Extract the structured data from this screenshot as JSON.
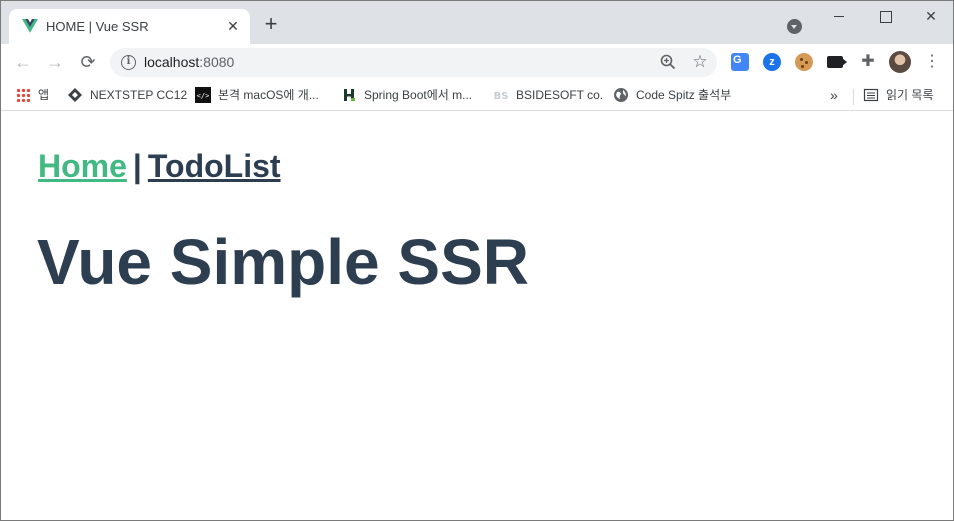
{
  "tab": {
    "title": "HOME | Vue SSR",
    "close_glyph": "✕",
    "new_tab_glyph": "+"
  },
  "toolbar": {
    "back_glyph": "←",
    "forward_glyph": "→",
    "reload_glyph": "⟳",
    "url_host": "localhost",
    "url_port": ":8080",
    "info_glyph": "i",
    "star_glyph": "☆",
    "ext_z_label": "z",
    "puzzle_glyph": "✚",
    "menu_glyph": "⋮"
  },
  "bookmarks": {
    "items": [
      {
        "label": "앱",
        "icon": "apps-grid-icon"
      },
      {
        "label": "NEXTSTEP CC12",
        "icon": "nextstep-icon"
      },
      {
        "label": "본격 macOS에 개...",
        "icon": "code-icon"
      },
      {
        "label": "Spring Boot에서 m...",
        "icon": "spring-icon"
      },
      {
        "label": "BSIDESOFT co.",
        "icon": "bsidesoft-icon"
      },
      {
        "label": "Code Spitz 출석부",
        "icon": "globe-icon"
      }
    ],
    "more_glyph": "»",
    "reading_list_label": "읽기 목록"
  },
  "page": {
    "nav_home": "Home",
    "nav_separator": "|",
    "nav_todo": "TodoList",
    "heading": "Vue Simple SSR"
  },
  "colors": {
    "vue_green": "#42b983",
    "vue_dark": "#2c3e50",
    "chrome_frame": "#dee1e6"
  }
}
